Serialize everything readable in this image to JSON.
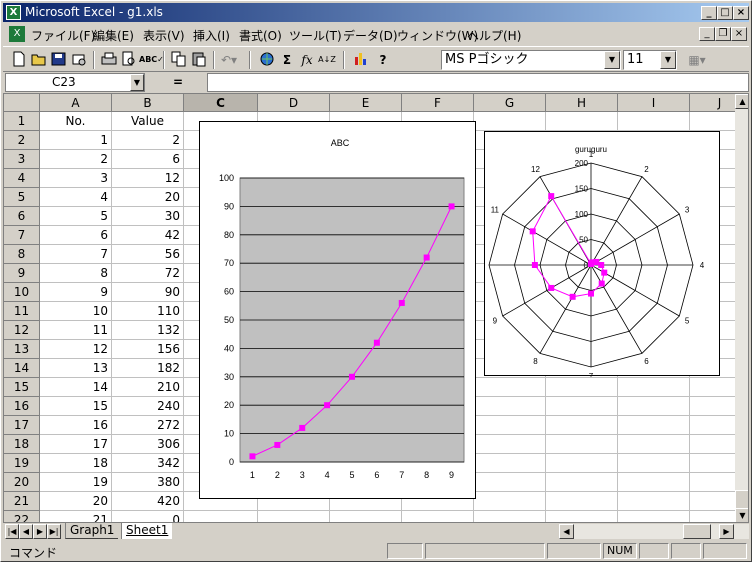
{
  "window": {
    "title": "Microsoft Excel - g1.xls",
    "app_icon": "excel-icon",
    "controls": [
      "_",
      "□",
      "×"
    ]
  },
  "menu": {
    "items": [
      "ファイル(F)",
      "編集(E)",
      "表示(V)",
      "挿入(I)",
      "書式(O)",
      "ツール(T)",
      "データ(D)",
      "ウィンドウ(W)",
      "ヘルプ(H)"
    ],
    "doc_controls": [
      "_",
      "❐",
      "×"
    ]
  },
  "toolbar": {
    "font_name": "MS Pゴシック",
    "font_size": "11",
    "buttons": [
      "new-icon",
      "open-icon",
      "save-icon",
      "permission-icon",
      "print-icon",
      "print-preview-icon",
      "spelling-icon",
      "copy-icon",
      "paste-icon",
      "undo-icon",
      "hyperlink-icon",
      "autosum-icon",
      "function-icon",
      "sort-icon",
      "chart-wizard-icon",
      "help-icon",
      "borders-icon"
    ],
    "glyphs": {
      "autosum": "Σ",
      "function": "fx",
      "sort": "A↓Z"
    }
  },
  "formula_bar": {
    "name_box": "C23",
    "equals": "="
  },
  "sheet": {
    "columns": [
      "A",
      "B",
      "C",
      "D",
      "E",
      "F",
      "G",
      "H",
      "I",
      "J"
    ],
    "selected_column": "C",
    "selected_row": "23",
    "rows": [
      {
        "num": "1",
        "a": "No.",
        "b": "Value"
      },
      {
        "num": "2",
        "a": "1",
        "b": "2"
      },
      {
        "num": "3",
        "a": "2",
        "b": "6"
      },
      {
        "num": "4",
        "a": "3",
        "b": "12"
      },
      {
        "num": "5",
        "a": "4",
        "b": "20"
      },
      {
        "num": "6",
        "a": "5",
        "b": "30"
      },
      {
        "num": "7",
        "a": "6",
        "b": "42"
      },
      {
        "num": "8",
        "a": "7",
        "b": "56"
      },
      {
        "num": "9",
        "a": "8",
        "b": "72"
      },
      {
        "num": "10",
        "a": "9",
        "b": "90"
      },
      {
        "num": "11",
        "a": "10",
        "b": "110"
      },
      {
        "num": "12",
        "a": "11",
        "b": "132"
      },
      {
        "num": "13",
        "a": "12",
        "b": "156"
      },
      {
        "num": "14",
        "a": "13",
        "b": "182"
      },
      {
        "num": "15",
        "a": "14",
        "b": "210"
      },
      {
        "num": "16",
        "a": "15",
        "b": "240"
      },
      {
        "num": "17",
        "a": "16",
        "b": "272"
      },
      {
        "num": "18",
        "a": "17",
        "b": "306"
      },
      {
        "num": "19",
        "a": "18",
        "b": "342"
      },
      {
        "num": "20",
        "a": "19",
        "b": "380"
      },
      {
        "num": "21",
        "a": "20",
        "b": "420"
      },
      {
        "num": "22",
        "a": "21",
        "b": "0"
      },
      {
        "num": "23",
        "a": "",
        "b": ""
      }
    ]
  },
  "chart_data": [
    {
      "type": "line",
      "title": "ABC",
      "categories": [
        "1",
        "2",
        "3",
        "4",
        "5",
        "6",
        "7",
        "8",
        "9"
      ],
      "values": [
        2,
        6,
        12,
        20,
        30,
        42,
        56,
        72,
        90
      ],
      "ylim": [
        0,
        100
      ],
      "yticks": [
        "0",
        "10",
        "20",
        "30",
        "40",
        "50",
        "60",
        "70",
        "80",
        "90",
        "100"
      ],
      "plot_bg": "#c0c0c0",
      "line_color": "#ff00ff",
      "grid": true
    },
    {
      "type": "radar",
      "title": "guruguru",
      "categories": [
        "1",
        "2",
        "3",
        "4",
        "5",
        "6",
        "7",
        "8",
        "9",
        "10",
        "11",
        "12"
      ],
      "values": [
        2,
        6,
        12,
        20,
        30,
        42,
        56,
        72,
        90,
        110,
        132,
        156
      ],
      "rlim": [
        0,
        200
      ],
      "rticks": [
        "0",
        "50",
        "100",
        "150",
        "200"
      ],
      "line_color": "#ff00ff"
    }
  ],
  "tabs": [
    "Graph1",
    "Sheet1"
  ],
  "active_tab": "Sheet1",
  "status": {
    "text": "コマンド",
    "num": "NUM"
  }
}
